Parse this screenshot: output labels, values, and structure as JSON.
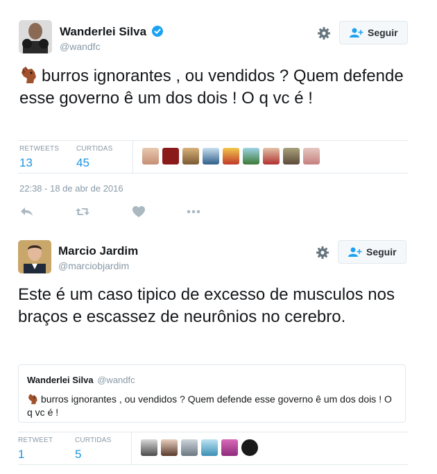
{
  "tweets": [
    {
      "author": {
        "name": "Wanderlei Silva",
        "handle": "@wandfc",
        "verified": true
      },
      "follow_label": "Seguir",
      "text": "burros ignorantes , ou vendidos ? Quem defende esse governo ê um dos dois ! O q vc é !",
      "emoji": "horse-face",
      "stats": [
        {
          "label": "RETWEETS",
          "value": "13"
        },
        {
          "label": "CURTIDAS",
          "value": "45"
        }
      ],
      "likers_count": 9,
      "timestamp": "22:38 - 18 de abr de 2016",
      "actions": [
        "reply-icon",
        "retweet-icon",
        "like-icon",
        "more-icon"
      ]
    },
    {
      "author": {
        "name": "Marcio Jardim",
        "handle": "@marciobjardim",
        "verified": false
      },
      "follow_label": "Seguir",
      "text": "Este é um caso tipico de excesso de musculos nos braços e escassez de neurônios no cerebro.",
      "quoted": {
        "name": "Wanderlei Silva",
        "handle": "@wandfc",
        "text": "burros ignorantes , ou vendidos ? Quem defende esse governo ê um dos dois ! O q vc é !"
      },
      "stats": [
        {
          "label": "RETWEET",
          "value": "1"
        },
        {
          "label": "CURTIDAS",
          "value": "5"
        }
      ],
      "likers_count": 6
    }
  ],
  "colors": {
    "link_blue": "#1b95e0",
    "muted": "#8899a6",
    "border": "#e1e8ed",
    "verified": "#1da1f2"
  }
}
